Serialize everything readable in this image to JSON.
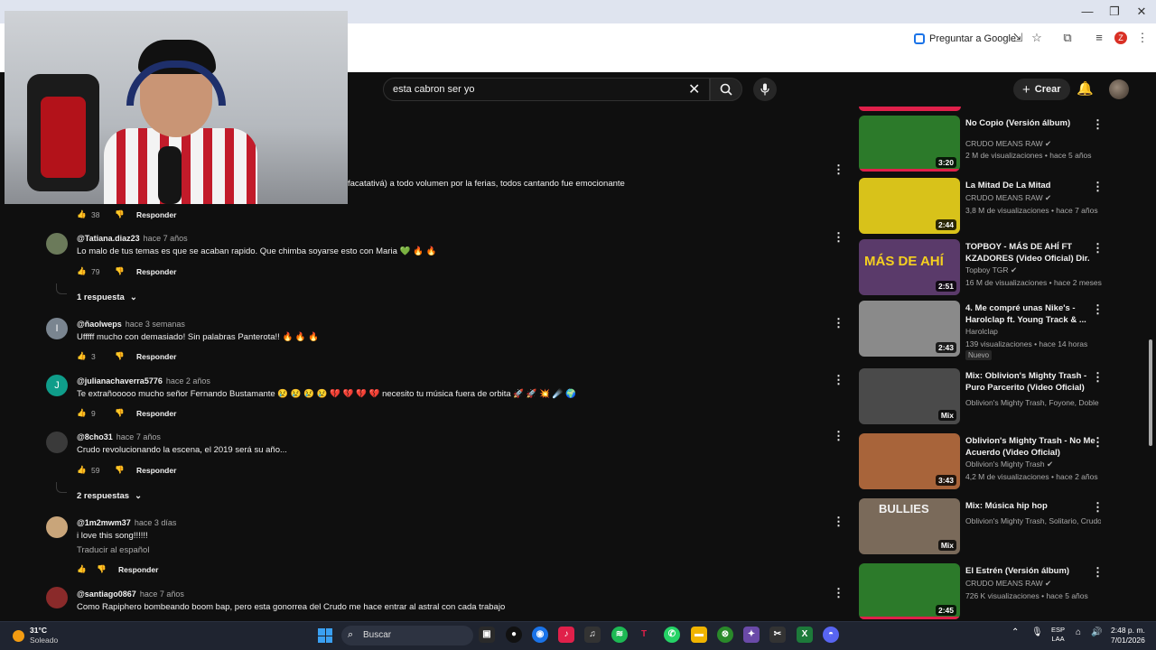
{
  "browser": {
    "ask_google": "Preguntar a Google",
    "profile_initial": "Z",
    "minimize": "—",
    "restore": "❐",
    "close": "✕"
  },
  "youtube": {
    "search_value": "esta cabron ser yo",
    "create_label": "Crear"
  },
  "partial_comment": {
    "text": "facatativá) a todo volumen por la ferias, todos cantando fue emocionante",
    "likes": "38"
  },
  "comments": [
    {
      "handle": "@Tatiana.diaz23",
      "ago": "hace 7 años",
      "text": "Lo malo de tus temas es que se acaban rapido. Que chimba soyarse esto con Maria 💚 🔥 🔥",
      "likes": "79",
      "replies": "1 respuesta",
      "avatar_color": "#6b7a5a",
      "initial": ""
    },
    {
      "handle": "@ñaolweps",
      "ago": "hace 3 semanas",
      "text": "Ufffff mucho con demasiado! Sin palabras Panterota!! 🔥 🔥 🔥",
      "likes": "3",
      "avatar_color": "#7a8590",
      "initial": "I"
    },
    {
      "handle": "@julianachaverra5776",
      "ago": "hace 2 años",
      "text": "Te extrañooooo mucho señor Fernando Bustamante 😢 😢 😢 😢 💔 💔 💔 💔 necesito tu música fuera de orbita 🚀 🚀 💥 ☄️ 🌍",
      "likes": "9",
      "avatar_color": "#0f9d8a",
      "initial": "J"
    },
    {
      "handle": "@8cho31",
      "ago": "hace 7 años",
      "text": "Crudo revolucionando la escena, el 2019 será su año...",
      "likes": "59",
      "replies": "2 respuestas",
      "avatar_color": "#3a3a3a",
      "initial": ""
    },
    {
      "handle": "@1m2mwm37",
      "ago": "hace 3 días",
      "text": "i love this song!!!!!!",
      "translate": "Traducir al español",
      "likes": "",
      "avatar_color": "#c9a57a",
      "initial": ""
    },
    {
      "handle": "@santiago0867",
      "ago": "hace 7 años",
      "text": "Como Rapiphero bombeando boom bap, pero esta gonorrea del Crudo me hace entrar al astral con cada trabajo",
      "avatar_color": "#8a2a2a",
      "initial": ""
    }
  ],
  "reply_label": "Responder",
  "related": [
    {
      "title": "No Copio (Versión álbum)",
      "channel": "CRUDO MEANS RAW",
      "verified": true,
      "meta": "2 M de visualizaciones • hace 5 años",
      "duration": "3:20",
      "thumb": "#2c7a2a"
    },
    {
      "title": "La Mitad De La Mitad",
      "channel": "CRUDO MEANS RAW",
      "verified": true,
      "meta": "3,8 M de visualizaciones • hace 7 años",
      "duration": "2:44",
      "thumb": "#d8c21a"
    },
    {
      "title": "TOPBOY - MÁS DE AHÍ FT KZADORES (Video Oficial) Dir. ...",
      "channel": "Topboy TGR",
      "verified": true,
      "meta": "16 M de visualizaciones • hace 2 meses",
      "duration": "2:51",
      "thumb": "#5a3a6a",
      "thumb_text": "MÁS DE AHÍ"
    },
    {
      "title": "4. Me compré unas Nike's - Harolclap ft. Young Track & ...",
      "channel": "Harolclap",
      "verified": false,
      "meta": "139 visualizaciones • hace 14 horas",
      "badge": "Nuevo",
      "duration": "2:43",
      "thumb": "#8a8a8a"
    },
    {
      "title": "Mix: Oblivion's Mighty Trash - Puro Parcerito (Video Oficial)",
      "channel": "Oblivion's Mighty Trash, Foyone, Doble P...",
      "verified": false,
      "meta": "",
      "duration": "Mix",
      "thumb": "#4a4a4a"
    },
    {
      "title": "Oblivion's Mighty Trash - No Me Acuerdo (Video Oficial)",
      "channel": "Oblivion's Mighty Trash",
      "verified": true,
      "meta": "4,2 M de visualizaciones • hace 2 años",
      "duration": "3:43",
      "thumb": "#a8643a"
    },
    {
      "title": "Mix: Música hip hop",
      "channel": "Oblivion's Mighty Trash, Solitario, Crudo ...",
      "verified": false,
      "meta": "",
      "duration": "Mix",
      "thumb": "#7a6a5a",
      "thumb_text": "BULLIES"
    },
    {
      "title": "El Estrén (Versión álbum)",
      "channel": "CRUDO MEANS RAW",
      "verified": true,
      "meta": "726 K visualizaciones • hace 5 años",
      "duration": "2:45",
      "thumb": "#2c7a2a"
    }
  ],
  "taskbar": {
    "temp": "31°C",
    "weather": "Soleado",
    "search": "Buscar",
    "lang_1": "ESP",
    "lang_2": "LAA",
    "time": "2:48 p. m.",
    "date": "7/01/2026"
  }
}
